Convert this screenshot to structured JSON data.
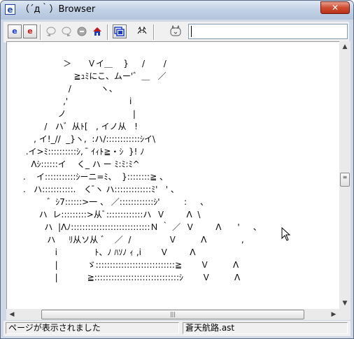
{
  "window": {
    "title": "（´д｀）Browser",
    "close_label": "✕"
  },
  "toolbar": {
    "buttons": [
      "e",
      "e"
    ],
    "address_value": ""
  },
  "content": {
    "ascii_art": "                     ＞      Ｖイ＿    }     /       /\n                         ≧ｭﾐにこ、ムー'゛＿   ／\n                       /           ヽ、\n                     ,'                       i\n                   ノ                         |\n              /   ハ゛从ﾄ[   , イノ从   !\n          , イ!_//  _}ヽ,  :ハ/::::::::::::ｼイ\\\n       .イ>ﾐ::::::::::ｼ,  ̄ ｲｨﾄ≧・ｼ  }! ﾉ\n         Λｼ::::::イ    く_ ハ ー ﾐ:ﾐ:ﾐ^\n      .    イ:::::::::::ｼーニ=ﾐ、  }::::::::≧ 、\n      .   ハ:::::::::::.   く ̄ヽ ハ:::::::::::::ﾐ'   ' 、\n               ゛ｼ7::::::>一 、 ／::::::::::::ｼ'         :     、\n            ハ  レ:::::::::>从ﾞ:::::::::::::ハ  Ｖ        Λ  \\\n              ハ  |Λﾉ::::::::::::::::::::::::::::Ｎ ｀ ／  Ｖ        Λ      '     、\n               ハ     ﾘ从ソ从 ゛  ／  /              Ｖ         Λ             ,\n                  i              ﾄ、ﾉ ﾊｿﾉ ｨ ,i       Ｖ        Λ\n                  |           ゞ::::::::::::::::::::::::::::≧       Ｖ         Λ\n                  |           ≧::::::::::::::::::::::::::::::ｼ       Ｖ         Λ"
  },
  "status": {
    "message": "ページが表示されました",
    "file": "蒼天航路.ast"
  },
  "scroll": {
    "vertical_position": 0.52,
    "horizontal_position": 0.5
  },
  "colors": {
    "accent": "#1a3ccf",
    "close": "#c8452c"
  }
}
